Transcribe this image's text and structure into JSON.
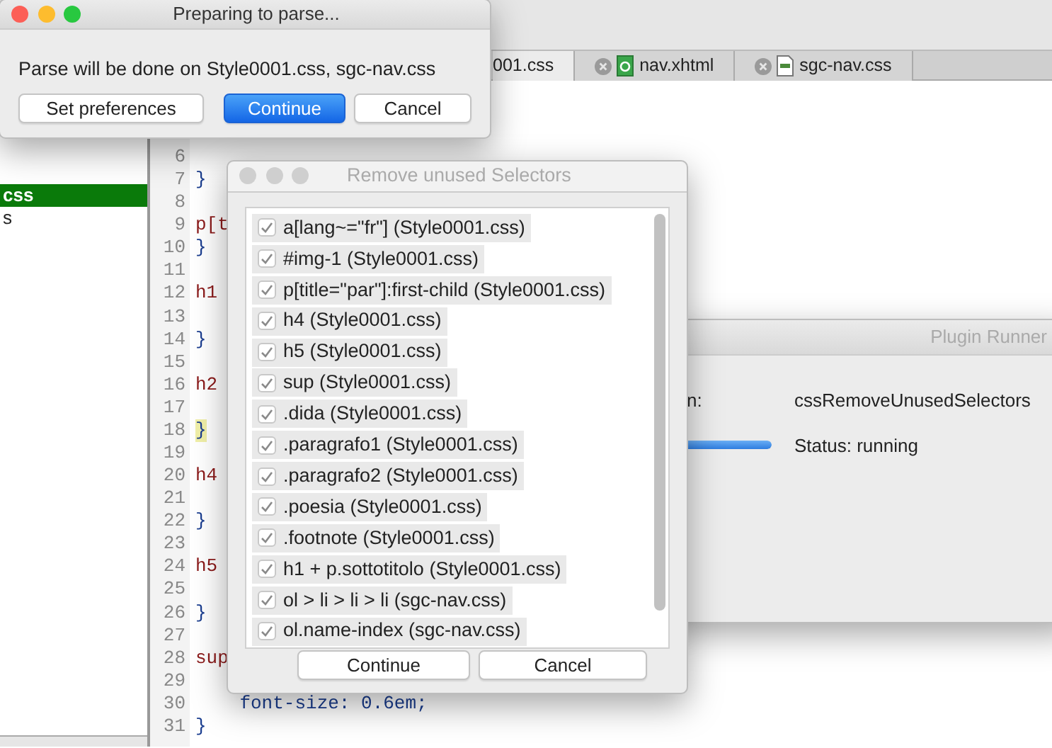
{
  "editor": {
    "tabs": [
      {
        "label": "001.css",
        "selected": true,
        "kind": "plain"
      },
      {
        "label": "nav.xhtml",
        "selected": false,
        "kind": "xhtml"
      },
      {
        "label": "sgc-nav.css",
        "selected": false,
        "kind": "css"
      }
    ],
    "sidebar": {
      "items": [
        {
          "label": "css",
          "selected": true
        },
        {
          "label": "s",
          "selected": false
        }
      ]
    },
    "code_lines": [
      {
        "number": "6",
        "kind": "blank",
        "highlighted": false
      },
      {
        "number": "7",
        "text": "}",
        "kind": "brace",
        "highlighted": false
      },
      {
        "number": "8",
        "kind": "blank",
        "highlighted": false
      },
      {
        "number": "9",
        "text": "p[t",
        "kind": "selector",
        "highlighted": false
      },
      {
        "number": "10",
        "text": "}",
        "kind": "brace",
        "highlighted": false
      },
      {
        "number": "11",
        "kind": "blank",
        "highlighted": false
      },
      {
        "number": "12",
        "text": "h1",
        "kind": "selector",
        "highlighted": false
      },
      {
        "number": "13",
        "kind": "blank",
        "highlighted": false
      },
      {
        "number": "14",
        "text": "}",
        "kind": "brace",
        "highlighted": false
      },
      {
        "number": "15",
        "kind": "blank",
        "highlighted": false
      },
      {
        "number": "16",
        "text": "h2",
        "kind": "selector",
        "highlighted": false
      },
      {
        "number": "17",
        "kind": "blank",
        "highlighted": false
      },
      {
        "number": "18",
        "text": "}",
        "kind": "brace",
        "highlighted": true
      },
      {
        "number": "19",
        "kind": "blank",
        "highlighted": false
      },
      {
        "number": "20",
        "text": "h4",
        "kind": "selector",
        "highlighted": false
      },
      {
        "number": "21",
        "kind": "blank",
        "highlighted": false
      },
      {
        "number": "22",
        "text": "}",
        "kind": "brace",
        "highlighted": false
      },
      {
        "number": "23",
        "kind": "blank",
        "highlighted": false
      },
      {
        "number": "24",
        "text": "h5",
        "kind": "selector",
        "highlighted": false
      },
      {
        "number": "25",
        "kind": "blank",
        "highlighted": false
      },
      {
        "number": "26",
        "text": "}",
        "kind": "brace",
        "highlighted": false
      },
      {
        "number": "27",
        "kind": "blank",
        "highlighted": false
      },
      {
        "number": "28",
        "text": "sup",
        "kind": "selector",
        "highlighted": false
      },
      {
        "number": "29",
        "kind": "blank",
        "highlighted": false
      },
      {
        "number": "30",
        "text": "    font-size: 0.6em;",
        "kind": "declaration",
        "highlighted": false
      },
      {
        "number": "31",
        "text": "}",
        "kind": "brace",
        "highlighted": false
      }
    ]
  },
  "plugin_runner": {
    "title": "Plugin Runner",
    "label": "n:",
    "plugin_name": "cssRemoveUnusedSelectors",
    "progress": {
      "level": 1
    },
    "status": "Status: running"
  },
  "prepare_dialog": {
    "title": "Preparing to parse...",
    "message": "Parse will be done on Style0001.css, sgc-nav.css",
    "buttons": [
      {
        "label": "Set preferences",
        "default": false
      },
      {
        "label": "Continue",
        "default": true
      },
      {
        "label": "Cancel",
        "default": false
      }
    ]
  },
  "selectors_dialog": {
    "title": "Remove unused Selectors",
    "items": [
      {
        "label": "a[lang~=\"fr\"] (Style0001.css)",
        "checked": true
      },
      {
        "label": "#img-1 (Style0001.css)",
        "checked": true
      },
      {
        "label": "p[title=\"par\"]:first-child (Style0001.css)",
        "checked": true
      },
      {
        "label": "h4 (Style0001.css)",
        "checked": true
      },
      {
        "label": "h5 (Style0001.css)",
        "checked": true
      },
      {
        "label": "sup (Style0001.css)",
        "checked": true
      },
      {
        "label": ".dida (Style0001.css)",
        "checked": true
      },
      {
        "label": ".paragrafo1 (Style0001.css)",
        "checked": true
      },
      {
        "label": ".paragrafo2 (Style0001.css)",
        "checked": true
      },
      {
        "label": ".poesia (Style0001.css)",
        "checked": true
      },
      {
        "label": ".footnote (Style0001.css)",
        "checked": true
      },
      {
        "label": "h1 + p.sottotitolo (Style0001.css)",
        "checked": true
      },
      {
        "label": "ol > li > li > li (sgc-nav.css)",
        "checked": true
      },
      {
        "label": "ol.name-index (sgc-nav.css)",
        "checked": true
      }
    ],
    "buttons": [
      {
        "label": "Continue",
        "default": false
      },
      {
        "label": "Cancel",
        "default": false
      }
    ]
  }
}
